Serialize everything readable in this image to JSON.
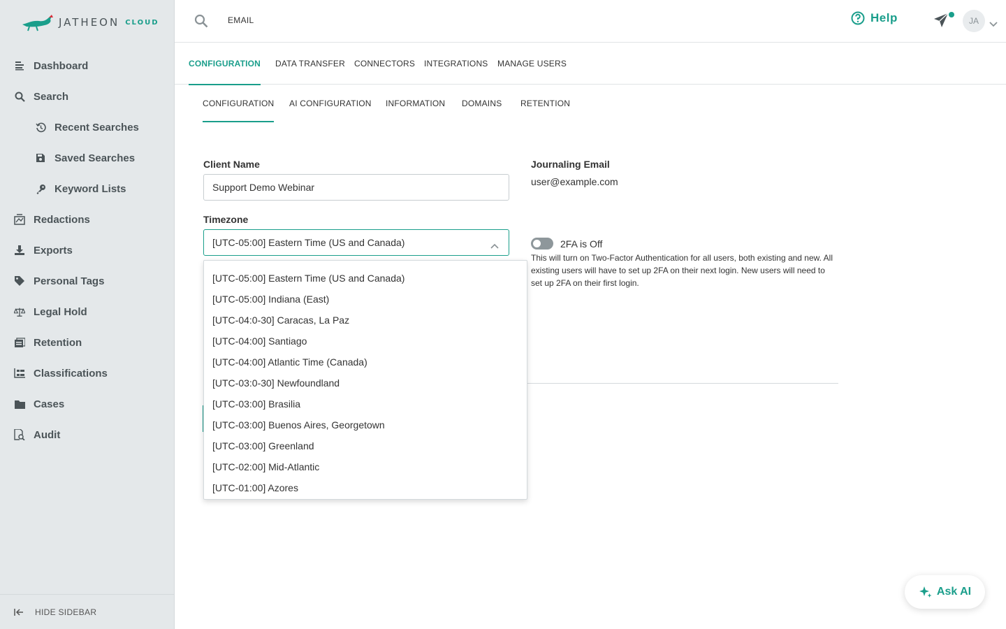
{
  "brand": {
    "name": "JATHEON",
    "product": "CLOUD"
  },
  "sidebar": {
    "items": [
      {
        "label": "Dashboard",
        "icon": "list-icon"
      },
      {
        "label": "Search",
        "icon": "search-icon"
      },
      {
        "label": "Recent Searches",
        "icon": "history-icon"
      },
      {
        "label": "Saved Searches",
        "icon": "save-icon"
      },
      {
        "label": "Keyword Lists",
        "icon": "key-icon"
      },
      {
        "label": "Redactions",
        "icon": "redaction-icon"
      },
      {
        "label": "Exports",
        "icon": "download-icon"
      },
      {
        "label": "Personal Tags",
        "icon": "tag-icon"
      },
      {
        "label": "Legal Hold",
        "icon": "scale-icon"
      },
      {
        "label": "Retention",
        "icon": "retention-icon"
      },
      {
        "label": "Classifications",
        "icon": "hierarchy-icon"
      },
      {
        "label": "Cases",
        "icon": "folder-icon"
      },
      {
        "label": "Audit",
        "icon": "audit-icon"
      }
    ],
    "hide_label": "HIDE SIDEBAR"
  },
  "topbar": {
    "search_label": "EMAIL",
    "help_label": "Help",
    "avatar_initials": "JA"
  },
  "main_tabs": [
    "CONFIGURATION",
    "DATA TRANSFER",
    "CONNECTORS",
    "INTEGRATIONS",
    "MANAGE USERS"
  ],
  "sub_tabs": [
    "CONFIGURATION",
    "AI CONFIGURATION",
    "INFORMATION",
    "DOMAINS",
    "RETENTION"
  ],
  "form": {
    "client_name_label": "Client Name",
    "client_name_value": "Support Demo Webinar",
    "journaling_label": "Journaling Email",
    "journaling_value": "user@example.com",
    "timezone_label": "Timezone",
    "timezone_value": "[UTC-05:00] Eastern Time (US and Canada)",
    "timezone_options": [
      "[UTC-05:00] Eastern Time (US and Canada)",
      "[UTC-05:00] Indiana (East)",
      "[UTC-04:0-30] Caracas, La Paz",
      "[UTC-04:00] Santiago",
      "[UTC-04:00] Atlantic Time (Canada)",
      "[UTC-03:0-30] Newfoundland",
      "[UTC-03:00] Brasilia",
      "[UTC-03:00] Buenos Aires, Georgetown",
      "[UTC-03:00] Greenland",
      "[UTC-02:00] Mid-Atlantic",
      "[UTC-01:00] Azores"
    ],
    "twofa_label": "2FA is Off",
    "twofa_description": "This will turn on Two-Factor Authentication for all users, both existing and new. All existing users will have to set up 2FA on their next login. New users will need to set up 2FA on their first login."
  },
  "ask_ai_label": "Ask AI",
  "colors": {
    "accent": "#1a9e8b",
    "sidebar_bg": "#e4e8ea"
  }
}
